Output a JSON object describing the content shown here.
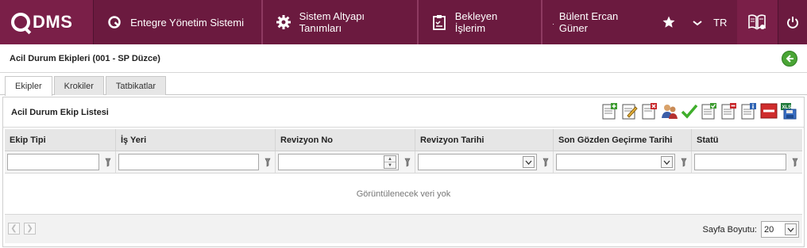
{
  "topbar": {
    "logo_text": "DMS",
    "nav": [
      {
        "label": "Entegre Yönetim Sistemi",
        "icon": "q-circle-icon"
      },
      {
        "label": "Sistem Altyapı Tanımları",
        "icon": "gear-icon"
      },
      {
        "label": "Bekleyen İşlerim",
        "icon": "clipboard-icon"
      }
    ],
    "user_name": "Bülent Ercan Güner",
    "language": "TR",
    "colors": {
      "bar": "#6b1a3f",
      "accent": "#7a1f48"
    }
  },
  "page": {
    "title": "Acil Durum Ekipleri (001 - SP Düzce)"
  },
  "tabs": [
    {
      "label": "Ekipler",
      "active": true
    },
    {
      "label": "Krokiler",
      "active": false
    },
    {
      "label": "Tatbikatlar",
      "active": false
    }
  ],
  "panel": {
    "title": "Acil Durum Ekip Listesi",
    "toolbar": [
      "add-record-icon",
      "edit-record-icon",
      "delete-record-icon",
      "users-icon",
      "approve-check-icon",
      "list-approve-icon",
      "list-remove-icon",
      "list-info-icon",
      "cancel-icon",
      "excel-export-icon"
    ]
  },
  "grid": {
    "columns": [
      "Ekip Tipi",
      "İş Yeri",
      "Revizyon No",
      "Revizyon Tarihi",
      "Son Gözden Geçirme Tarihi",
      "Statü"
    ],
    "empty_text": "Görüntülenecek veri yok"
  },
  "pager": {
    "page_size_label": "Sayfa Boyutu:",
    "page_size_value": "20"
  }
}
